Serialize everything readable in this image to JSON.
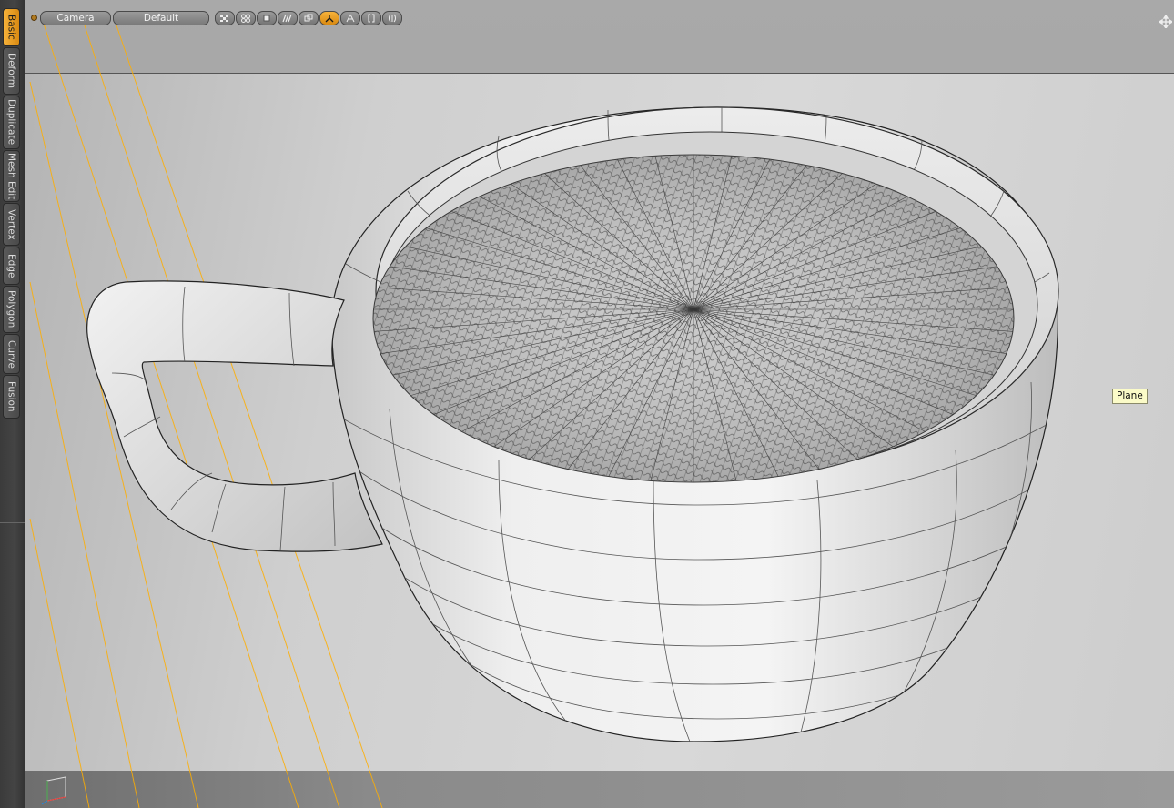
{
  "sidebar": {
    "tabs": [
      {
        "label": "Basic",
        "active": true
      },
      {
        "label": "Deform",
        "active": false
      },
      {
        "label": "Duplicate",
        "active": false
      },
      {
        "label": "Mesh Edit",
        "active": false
      },
      {
        "label": "Vertex",
        "active": false
      },
      {
        "label": "Edge",
        "active": false
      },
      {
        "label": "Polygon",
        "active": false
      },
      {
        "label": "Curve",
        "active": false
      },
      {
        "label": "Fusion",
        "active": false
      }
    ]
  },
  "viewport": {
    "view_dropdown": "Camera",
    "style_dropdown": "Default",
    "tool_buttons": [
      {
        "icon": "checker-icon",
        "active": false
      },
      {
        "icon": "grid-dots-icon",
        "active": false
      },
      {
        "icon": "square-icon",
        "active": false
      },
      {
        "icon": "stripes-icon",
        "active": false
      },
      {
        "icon": "copy-icon",
        "active": false
      },
      {
        "icon": "lambda-icon",
        "active": true
      },
      {
        "icon": "triangle-icon",
        "active": false
      },
      {
        "icon": "bracket-icon",
        "active": false
      },
      {
        "icon": "double-bracket-icon",
        "active": false
      }
    ],
    "tooltip": "Plane"
  },
  "colors": {
    "accent": "#f0a020",
    "grid_line": "#ffae00",
    "tooltip_bg": "#fbfbc8"
  }
}
